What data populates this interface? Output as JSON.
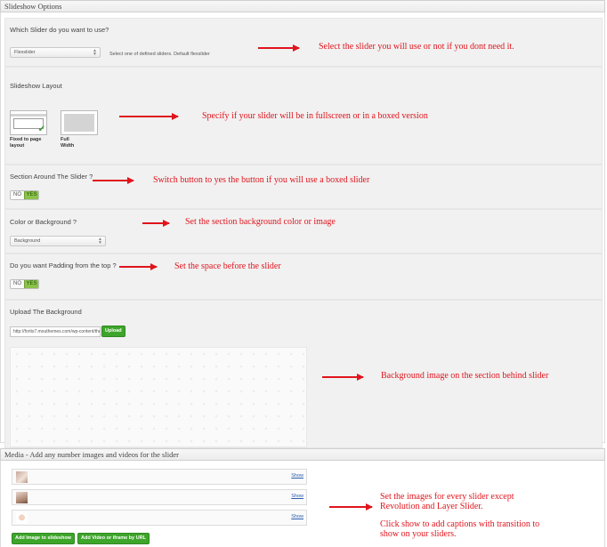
{
  "slideshow_panel": {
    "title": "Slideshow Options"
  },
  "which_slider": {
    "label": "Which Slider do you want to use?",
    "selected": "Flexslider",
    "hint": "Select one of defined sliders. Default flexslider",
    "annotation": "Select the slider you will use or  not if you dont need it."
  },
  "layout": {
    "label": "Slideshow Layout",
    "options": [
      {
        "label": "Fixed to page layout",
        "selected": true
      },
      {
        "label": "Full Width",
        "selected": false
      }
    ],
    "annotation": "Specify if your slider will be in fullscreen or in a boxed version"
  },
  "section_around": {
    "label": "Section Around The Slider ?",
    "toggle": {
      "no": "NO",
      "yes": "YES",
      "value": "yes"
    },
    "annotation": "Switch button to yes the button if you will use a boxed slider"
  },
  "color_bg": {
    "label": "Color or Background ?",
    "selected": "Background",
    "annotation": "Set the section background color or image"
  },
  "padding_top": {
    "label": "Do you want Padding from the top ?",
    "toggle": {
      "no": "NO",
      "yes": "YES",
      "value": "yes"
    },
    "annotation": "Set the space before the slider"
  },
  "upload_bg": {
    "label": "Upload The Background",
    "url_value": "http://fortis7.mouthemes.com/wp-content/the",
    "upload_button": "Upload",
    "annotation": "Background image on the section behind slider"
  },
  "media_panel": {
    "title": "Media - Add any number images and videos for the slider",
    "items": [
      {
        "show": "Show"
      },
      {
        "show": "Show"
      },
      {
        "show": "Show"
      }
    ],
    "add_image_button": "Add Image to slideshow",
    "add_video_button": "Add Video or iframe by URL",
    "annotation_line1": "Set the images for every slider except",
    "annotation_line2": "Revolution and Layer Slider.",
    "annotation_line3": "Click show to add captions with transition to",
    "annotation_line4": " show on your sliders."
  },
  "colors": {
    "annotation_red": "#e0141c",
    "button_green": "#3ea52b",
    "toggle_yes": "#8ac24a"
  }
}
